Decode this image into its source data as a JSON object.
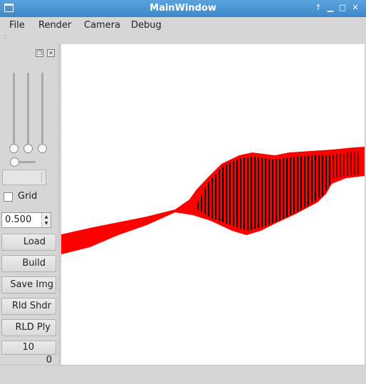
{
  "window": {
    "title": "MainWindow"
  },
  "menu": {
    "items": [
      "File",
      "Render",
      "Camera",
      "Debug"
    ]
  },
  "panel": {
    "sliders": [
      {
        "name": "slider-1",
        "value": 0
      },
      {
        "name": "slider-2",
        "value": 0
      },
      {
        "name": "slider-3",
        "value": 0
      },
      {
        "name": "h-slider",
        "value": 0
      }
    ],
    "combo_value": "",
    "grid_label": "Grid",
    "grid_checked": false,
    "spin_value": "0.500",
    "buttons": {
      "load": "Load",
      "build": "Build",
      "save_img": "Save Img",
      "rld_shdr": "Rld Shdr",
      "rld_ply": "RLD Ply",
      "ten": "10"
    },
    "counter": "0"
  },
  "colors": {
    "shape": "#ff0000",
    "shade": "#000000",
    "viewport_bg": "#ffffff"
  }
}
